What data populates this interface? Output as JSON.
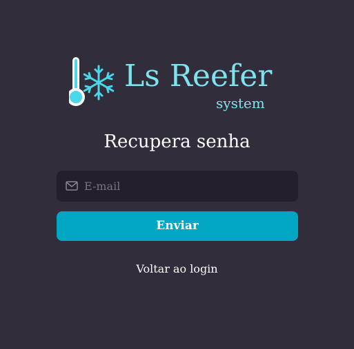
{
  "logo": {
    "title": "Ls Reefer",
    "subtitle": "system",
    "icon": "thermometer-snowflake-icon",
    "color": "#7fe3ef"
  },
  "form": {
    "title": "Recupera senha",
    "email_placeholder": "E-mail",
    "email_icon": "mail-icon",
    "submit_label": "Enviar",
    "back_link_label": "Voltar ao login"
  },
  "colors": {
    "background": "#312d3b",
    "input_background": "#24202b",
    "accent": "#00a6c2",
    "text": "#ffffff"
  }
}
